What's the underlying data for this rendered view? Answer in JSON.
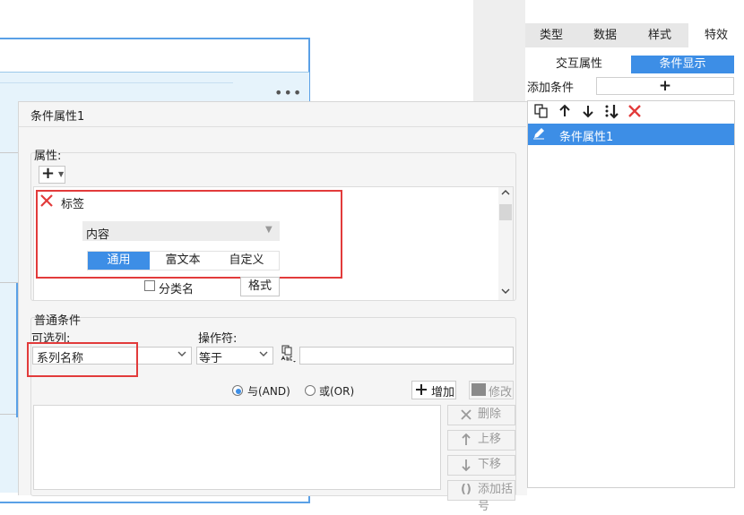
{
  "right_panel": {
    "tabs": [
      {
        "label": "类型"
      },
      {
        "label": "数据"
      },
      {
        "label": "样式"
      },
      {
        "label": "特效"
      }
    ],
    "subtabs": [
      {
        "label": "交互属性"
      },
      {
        "label": "条件显示"
      }
    ],
    "add_condition_label": "添加条件",
    "add_condition_button": "+",
    "toolbar_icons": [
      "copy-icon",
      "arrow-up-icon",
      "arrow-down-icon",
      "move-bottom-icon",
      "delete-icon"
    ],
    "list_items": [
      {
        "label": "条件属性1",
        "icon": "edit-icon"
      }
    ]
  },
  "dialog": {
    "title": "条件属性1",
    "properties": {
      "section_label": "属性:",
      "add_button": "+",
      "item_label": "标签",
      "content_select_value": "内容",
      "segments": [
        {
          "label": "通用"
        },
        {
          "label": "富文本"
        },
        {
          "label": "自定义"
        }
      ],
      "category_checkbox_label": "分类名",
      "format_button": "格式"
    },
    "condition": {
      "section_label": "普通条件",
      "column_label": "可选列:",
      "column_value": "系列名称",
      "operator_label": "操作符:",
      "operator_value": "等于",
      "value_input": "",
      "and_label": "与(AND)",
      "or_label": "或(OR)",
      "add_button": "增加",
      "modify_button": "修改",
      "delete_button": "删除",
      "move_up_button": "上移",
      "move_down_button": "下移",
      "add_bracket_button": "添加括号"
    }
  },
  "colors": {
    "accent": "#3d8ee6",
    "highlight_red": "#e23b3b"
  }
}
